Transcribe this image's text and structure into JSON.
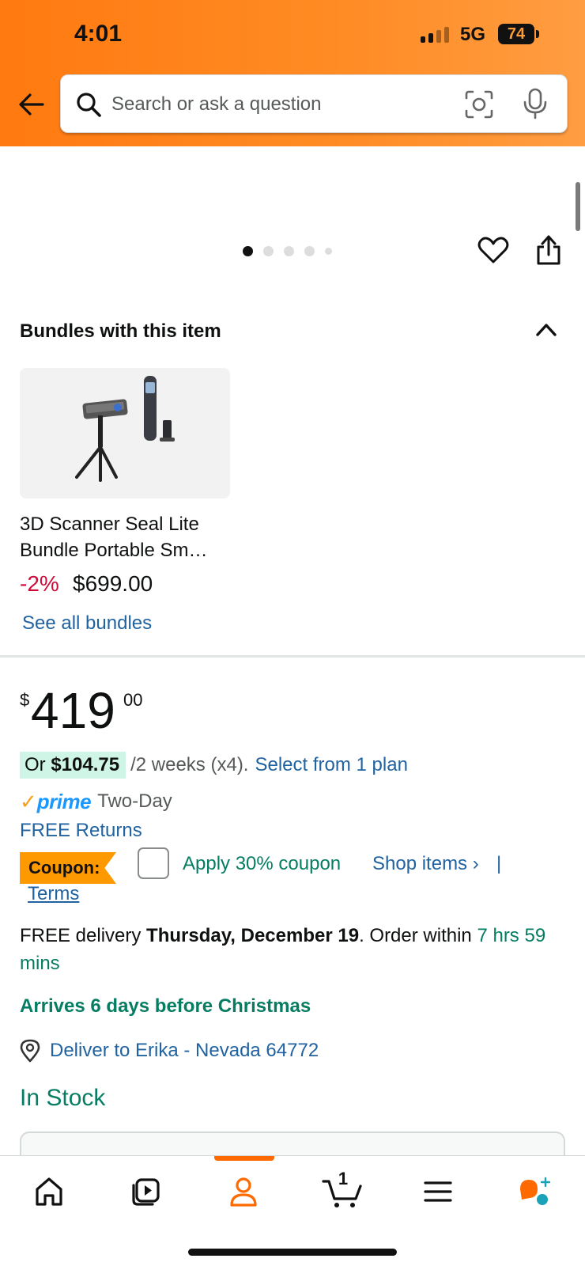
{
  "status_bar": {
    "time": "4:01",
    "network": "5G",
    "battery": "74"
  },
  "search": {
    "placeholder": "Search or ask a question"
  },
  "carousel": {
    "dot_count": 5,
    "active_index": 0
  },
  "bundles": {
    "title": "Bundles with this item",
    "item": {
      "name": "3D Scanner Seal Lite Bundle Portable Sm…",
      "discount": "-2%",
      "price": "$699.00"
    },
    "see_all": "See all bundles"
  },
  "price": {
    "currency": "$",
    "whole": "419",
    "fraction": "00"
  },
  "installment": {
    "or_label": "Or ",
    "amount": "$104.75",
    "terms": "/2 weeks (x4).",
    "plan_link": "Select from 1 plan"
  },
  "prime": {
    "check": "✓",
    "word": "prime",
    "type": "Two-Day"
  },
  "free_returns": "FREE Returns",
  "coupon": {
    "badge": "Coupon:",
    "apply": "Apply 30% coupon",
    "shop": "Shop items ›",
    "separator": "|",
    "terms": "Terms"
  },
  "delivery": {
    "prefix": "FREE delivery ",
    "date": "Thursday, December 19",
    "order_within": ". Order within ",
    "countdown": "7 hrs 59 mins"
  },
  "christmas_note": "Arrives 6 days before Christmas",
  "deliver_to": "Deliver to Erika - Nevada 64772",
  "stock_status": "In Stock",
  "bottom_nav": {
    "cart_count": "1",
    "active_tab": "account"
  },
  "colors": {
    "header_orange": "#ff8c25",
    "link_blue": "#2162a1",
    "success_green": "#067d62",
    "discount_red": "#cc0c39",
    "prime_blue": "#1a98ff",
    "coupon_orange": "#ff9900"
  }
}
